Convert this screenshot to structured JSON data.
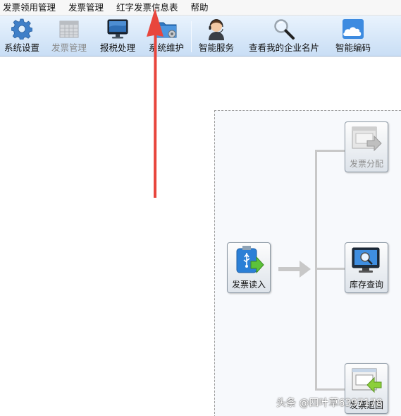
{
  "menu": [
    {
      "label": "发票领用管理"
    },
    {
      "label": "发票管理"
    },
    {
      "label": "红字发票信息表"
    },
    {
      "label": "帮助"
    }
  ],
  "toolbar": [
    {
      "label": "系统设置",
      "icon": "gear-icon",
      "enabled": true
    },
    {
      "label": "发票管理",
      "icon": "invoice-grid-icon",
      "enabled": false
    },
    {
      "label": "报税处理",
      "icon": "monitor-icon",
      "enabled": true
    },
    {
      "label": "系统维护",
      "icon": "folder-gear-icon",
      "enabled": true
    },
    {
      "label": "智能服务",
      "icon": "service-agent-icon",
      "enabled": true
    },
    {
      "label": "查看我的企业名片",
      "icon": "magnifier-icon",
      "enabled": true
    },
    {
      "label": "智能编码",
      "icon": "cloud-icon",
      "enabled": true
    }
  ],
  "flow": {
    "source": {
      "label": "发票读入",
      "icon": "usb-read-icon"
    },
    "targets": [
      {
        "label": "发票分配",
        "icon": "invoice-distribute-icon",
        "enabled": false
      },
      {
        "label": "库存查询",
        "icon": "stock-query-icon",
        "enabled": true
      },
      {
        "label": "发票退回",
        "icon": "invoice-return-icon",
        "enabled": true
      }
    ]
  },
  "annotation": {
    "color": "#e8453c"
  },
  "watermark": {
    "text": "头条 @四叶草6397178"
  }
}
